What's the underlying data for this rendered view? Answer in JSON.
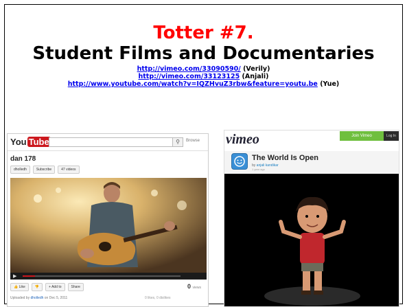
{
  "slide": {
    "title": "Totter #7.",
    "subtitle": "Student Films and Documentaries",
    "links": [
      {
        "url": "http://vimeo.com/33090590/",
        "who": "(Verily)"
      },
      {
        "url": "http://vimeo.com/33123125",
        "who": "(Anjali)"
      },
      {
        "url": "http://www.youtube.com/watch?v=IQZHvuZ3rbw&feature=youtu.be",
        "who": "(Yue)"
      }
    ],
    "colors": {
      "title": "#ff0000",
      "link": "#0000ee"
    }
  },
  "youtube": {
    "logo_you": "You",
    "logo_tube": "Tube",
    "search_icon": "search-icon",
    "browse_label": "Browse",
    "channel_name": "dan 178",
    "buttons": [
      "dholledh",
      "Subscribe",
      "47 videos"
    ],
    "like_label": "Like",
    "add_label": "+ Add to",
    "share_label": "Share",
    "views": "0",
    "views_unit": "views",
    "uploaded_by_prefix": "Uploaded by",
    "uploader": "dholledh",
    "uploaded_date": "on Dec 5, 2011",
    "likes_info": "0 likes, 0 dislikes",
    "progress": 0.08,
    "accent": "#cc181e"
  },
  "vimeo": {
    "logo": "vimeo",
    "join_label": "Join Vimeo",
    "login_label": "Log In",
    "video_title": "The World Is Open",
    "by_prefix": "by",
    "author": "anjali kandikar",
    "when": "1 year ago",
    "accent": "#6fbf3e"
  }
}
